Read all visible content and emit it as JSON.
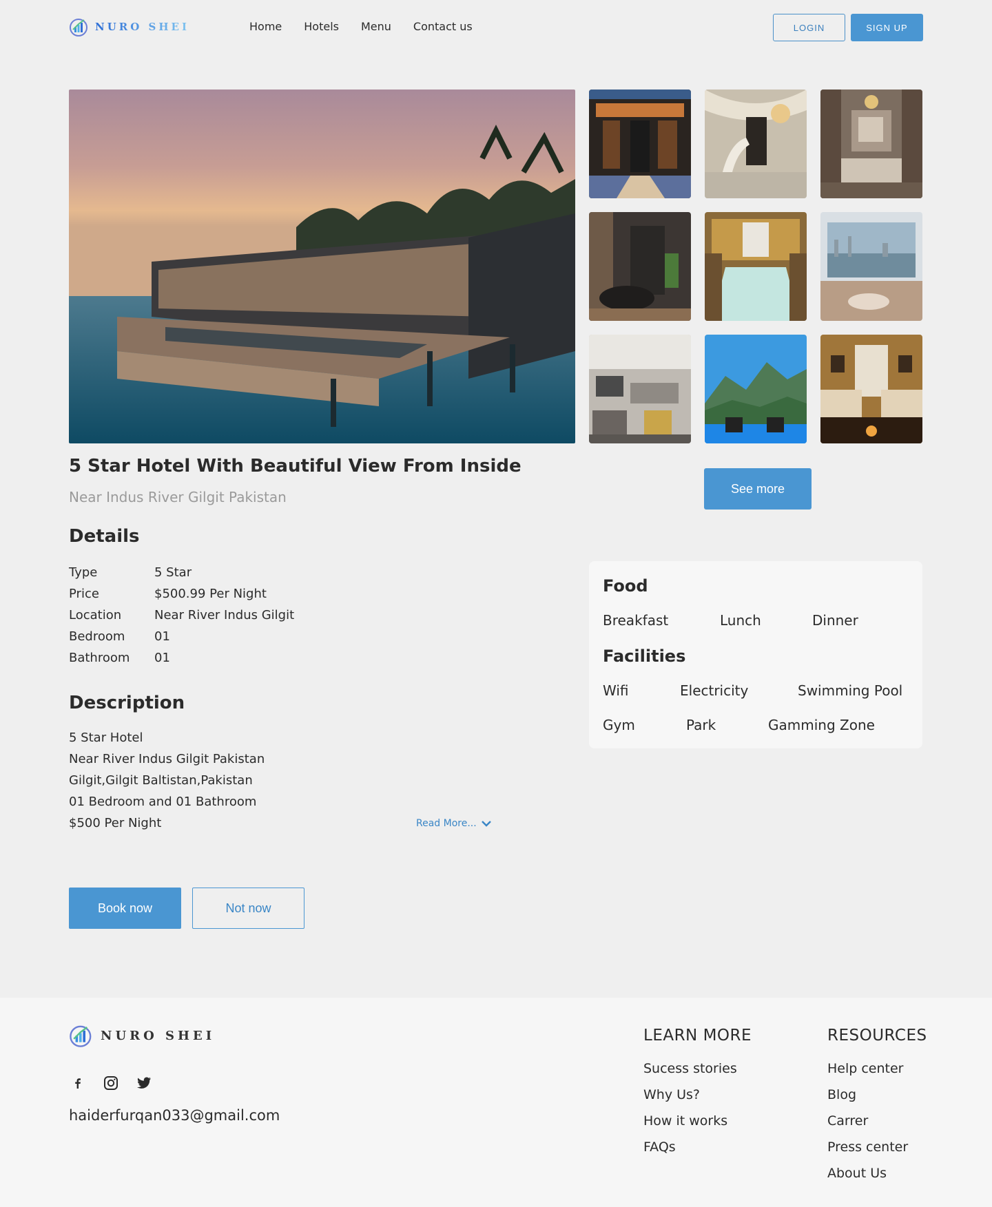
{
  "brand": {
    "name": "NURO SHEI"
  },
  "nav": {
    "items": [
      "Home",
      "Hotels",
      "Menu",
      "Contact us"
    ]
  },
  "auth": {
    "login": "LOGIN",
    "signup": "SIGN UP"
  },
  "hotel": {
    "title": "5 Star Hotel With Beautiful View From Inside",
    "subtitle": "Near Indus River Gilgit Pakistan",
    "see_more": "See more"
  },
  "details": {
    "heading": "Details",
    "rows": [
      {
        "key": "Type",
        "value": "5 Star"
      },
      {
        "key": "Price",
        "value": "$500.99 Per Night"
      },
      {
        "key": "Location",
        "value": "Near River Indus Gilgit"
      },
      {
        "key": "Bedroom",
        "value": "01"
      },
      {
        "key": "Bathroom",
        "value": "01"
      }
    ]
  },
  "description": {
    "heading": "Description",
    "lines": [
      "5 Star Hotel",
      "Near River Indus Gilgit Pakistan",
      "Gilgit,Gilgit Baltistan,Pakistan",
      "01 Bedroom and 01 Bathroom",
      "$500 Per Night"
    ],
    "read_more": "Read More..."
  },
  "actions": {
    "book": "Book now",
    "not_now": "Not now"
  },
  "amenities": {
    "food_heading": "Food",
    "food": [
      "Breakfast",
      "Lunch",
      "Dinner"
    ],
    "facilities_heading": "Facilities",
    "facilities": [
      "Wifi",
      "Electricity",
      "Swimming Pool",
      "Gym",
      "Park",
      "Gamming Zone"
    ]
  },
  "footer": {
    "email": "haiderfurqan033@gmail.com",
    "social_icons": [
      "facebook-icon",
      "instagram-icon",
      "twitter-icon"
    ],
    "learn_more": {
      "heading": "LEARN MORE",
      "links": [
        "Sucess stories",
        "Why Us?",
        "How it works",
        "FAQs"
      ]
    },
    "resources": {
      "heading": "RESOURCES",
      "links": [
        "Help center",
        "Blog",
        "Carrer",
        "Press center",
        "About Us"
      ]
    }
  },
  "colors": {
    "accent": "#4a96d2",
    "background": "#efefef",
    "footer_bg": "#f6f6f6"
  }
}
